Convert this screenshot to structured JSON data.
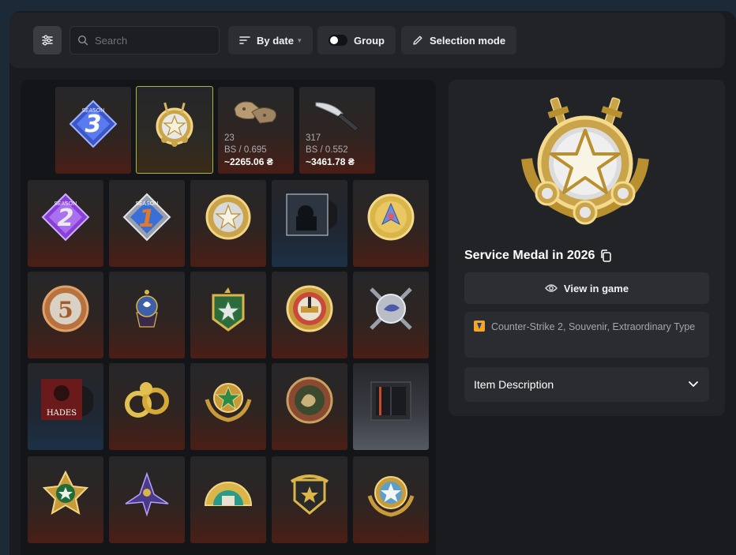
{
  "toolbar": {
    "search_placeholder": "Search",
    "sort_label": "By date",
    "group_label": "Group",
    "selection_label": "Selection mode"
  },
  "grid": {
    "row1": [
      {
        "name": "Season 3 coin",
        "kind": "season",
        "num": "3",
        "colors": [
          "#3b57c8",
          "#8aa6ff"
        ]
      },
      {
        "name": "Service Medal",
        "kind": "medal-star",
        "selected": true
      },
      {
        "name": "Gloves",
        "kind": "gloves",
        "count": "23",
        "wear": "BS / 0.695",
        "price": "~2265.06 ₴"
      },
      {
        "name": "Knife",
        "kind": "knife",
        "count": "317",
        "wear": "BS / 0.552",
        "price": "~3461.78 ₴"
      }
    ],
    "row2": [
      {
        "name": "Season 2 coin",
        "kind": "season",
        "num": "2",
        "colors": [
          "#8a3fd6",
          "#c8a8ff"
        ]
      },
      {
        "name": "Season 1 coin",
        "kind": "season",
        "num": "1",
        "colors": [
          "#3a6fd8",
          "#e07a2a"
        ]
      },
      {
        "name": "Silver star medal",
        "kind": "round-star"
      },
      {
        "name": "Music kit",
        "kind": "music",
        "bg": "blue"
      },
      {
        "name": "Gold coin",
        "kind": "gold-coin"
      }
    ],
    "row3": [
      {
        "name": "5 Year coin",
        "kind": "five",
        "num": "5"
      },
      {
        "name": "Cupcake pin",
        "kind": "cupcake"
      },
      {
        "name": "Green star medal",
        "kind": "green-medal"
      },
      {
        "name": "Stadium coin",
        "kind": "stadium"
      },
      {
        "name": "Operation coin",
        "kind": "crossed"
      }
    ],
    "row4": [
      {
        "name": "Hades music kit",
        "kind": "hades",
        "bg": "blue",
        "label": "HADES"
      },
      {
        "name": "Gold rings coin",
        "kind": "rings"
      },
      {
        "name": "Green laurel medal",
        "kind": "laurel"
      },
      {
        "name": "Operation Hydra coin",
        "kind": "hydra"
      },
      {
        "name": "Case",
        "kind": "case",
        "bg": "grey"
      }
    ],
    "row5": [
      {
        "name": "Green star pin",
        "kind": "green-pin"
      },
      {
        "name": "Purple phoenix pin",
        "kind": "phoenix"
      },
      {
        "name": "Landmark coin",
        "kind": "landmark"
      },
      {
        "name": "Crest pin",
        "kind": "crest"
      },
      {
        "name": "Service medal gold",
        "kind": "medal-star2"
      }
    ]
  },
  "detail": {
    "title": "Service Medal in 2026",
    "view_label": "View in game",
    "tags_text": "Counter-Strike 2, Souvenir, Extraordinary Type",
    "description_label": "Item Description"
  },
  "colors": {
    "accent_selected": "#a8b83a",
    "tile_red": "#4a1e16",
    "panel": "#222327"
  }
}
